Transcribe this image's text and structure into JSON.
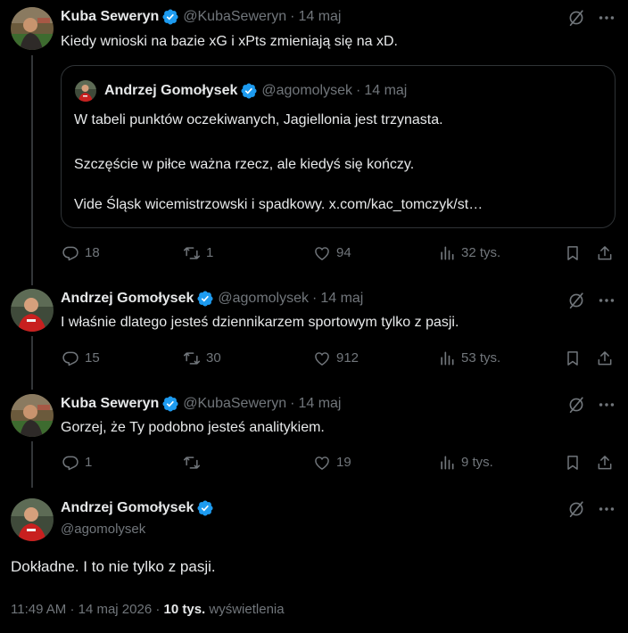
{
  "colors": {
    "background": "#000000",
    "text": "#e7e9ea",
    "muted": "#71767b",
    "verified": "#1d9bf0",
    "border": "#2f3336"
  },
  "tweets": [
    {
      "author_name": "Kuba Seweryn",
      "handle": "@KubaSeweryn",
      "separator": "·",
      "time": "14 maj",
      "text": "Kiedy wnioski na bazie xG i xPts zmieniają się na xD.",
      "quote": {
        "author_name": "Andrzej Gomołysek",
        "handle": "@agomolysek",
        "separator": "·",
        "time": "14 maj",
        "lines": [
          "W tabeli punktów oczekiwanych, Jagiellonia jest trzynasta.",
          "Szczęście w piłce ważna rzecz, ale kiedyś się kończy.",
          "Vide Śląsk wicemistrzowski i spadkowy. x.com/kac_tomczyk/st…"
        ]
      },
      "replies": "18",
      "reposts": "1",
      "likes": "94",
      "views": "32 tys."
    },
    {
      "author_name": "Andrzej Gomołysek",
      "handle": "@agomolysek",
      "separator": "·",
      "time": "14 maj",
      "text": "I właśnie dlatego jesteś dziennikarzem sportowym tylko z pasji.",
      "replies": "15",
      "reposts": "30",
      "likes": "912",
      "views": "53 tys."
    },
    {
      "author_name": "Kuba Seweryn",
      "handle": "@KubaSeweryn",
      "separator": "·",
      "time": "14 maj",
      "text": "Gorzej, że Ty podobno jesteś analitykiem.",
      "replies": "1",
      "reposts": "",
      "likes": "19",
      "views": "9 tys."
    }
  ],
  "main_tweet": {
    "author_name": "Andrzej Gomołysek",
    "handle": "@agomolysek",
    "text": "Dokładne. I to nie tylko z pasji.",
    "time": "11:49 AM",
    "sep1": "·",
    "date": "14 maj 2026",
    "sep2": "·",
    "views_count": "10 tys.",
    "views_label": "wyświetlenia"
  },
  "icons": [
    "verified-badge-icon",
    "grok-icon",
    "more-icon",
    "reply-icon",
    "repost-icon",
    "like-icon",
    "views-icon",
    "bookmark-icon",
    "share-icon"
  ]
}
